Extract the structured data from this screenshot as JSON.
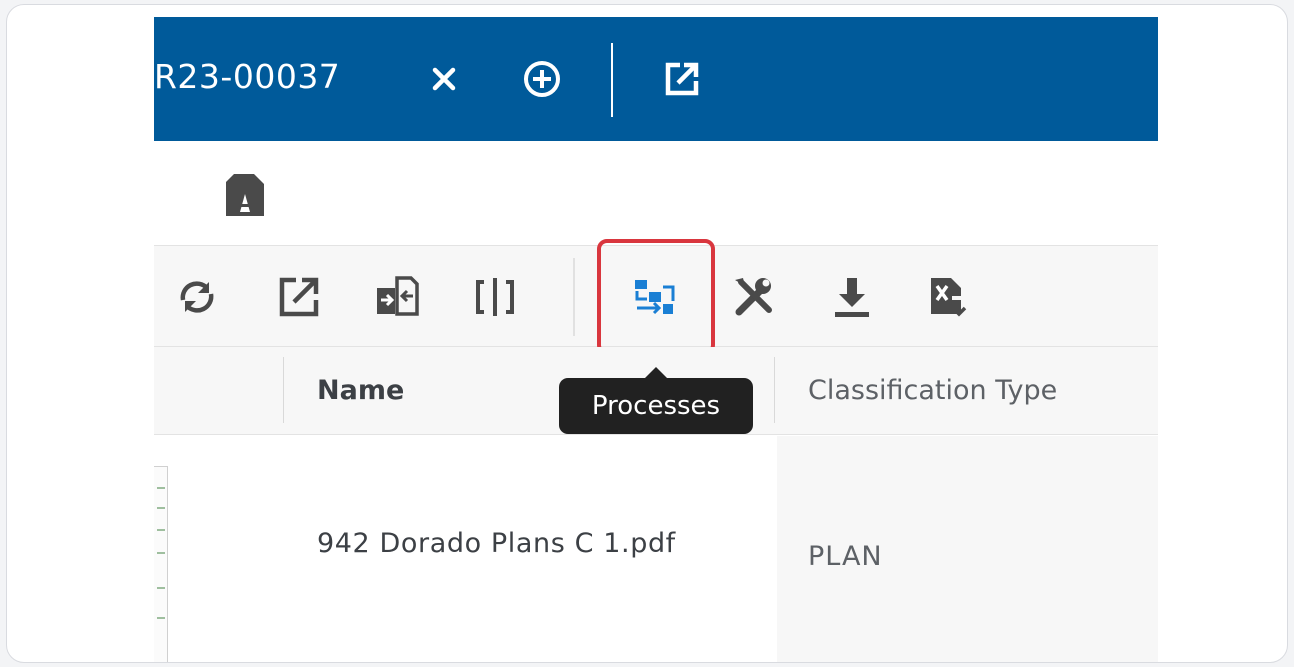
{
  "header": {
    "record_id": "R23-00037",
    "close_icon": "close-icon",
    "add_icon": "add-circle-icon",
    "open_external_icon": "open-external-icon",
    "background_color": "#005a9a"
  },
  "toolbar": {
    "buttons": [
      {
        "icon": "refresh-icon"
      },
      {
        "icon": "open-external-icon"
      },
      {
        "icon": "attach-document-icon"
      },
      {
        "icon": "split-view-icon"
      },
      {
        "icon": "processes-icon",
        "highlighted": true
      },
      {
        "icon": "tools-icon"
      },
      {
        "icon": "download-icon"
      },
      {
        "icon": "export-excel-icon"
      }
    ],
    "highlight_color": "#d9363e"
  },
  "tooltip": {
    "text": "Processes"
  },
  "table": {
    "columns": [
      "Name",
      "Classification Type"
    ],
    "rows": [
      {
        "name": "942 Dorado Plans C 1.pdf",
        "classification": "PLAN"
      }
    ]
  }
}
